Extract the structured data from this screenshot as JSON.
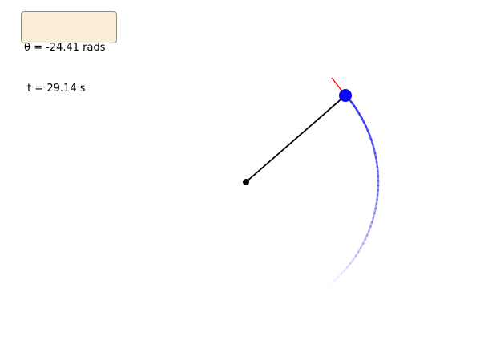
{
  "info_box": {
    "theta_text": "θ = -24.41 rads",
    "time_text": " t = 29.14 s"
  },
  "simulation": {
    "theta_rad": -24.41,
    "time_s": 29.14
  },
  "colors": {
    "rod": "#000000",
    "pivot": "#000000",
    "bob": "#0a0af5",
    "trail": "#2a2af0",
    "velocity_vector": "#ff0000",
    "info_background": "#fbeed6",
    "info_border": "#8c8c8c"
  }
}
